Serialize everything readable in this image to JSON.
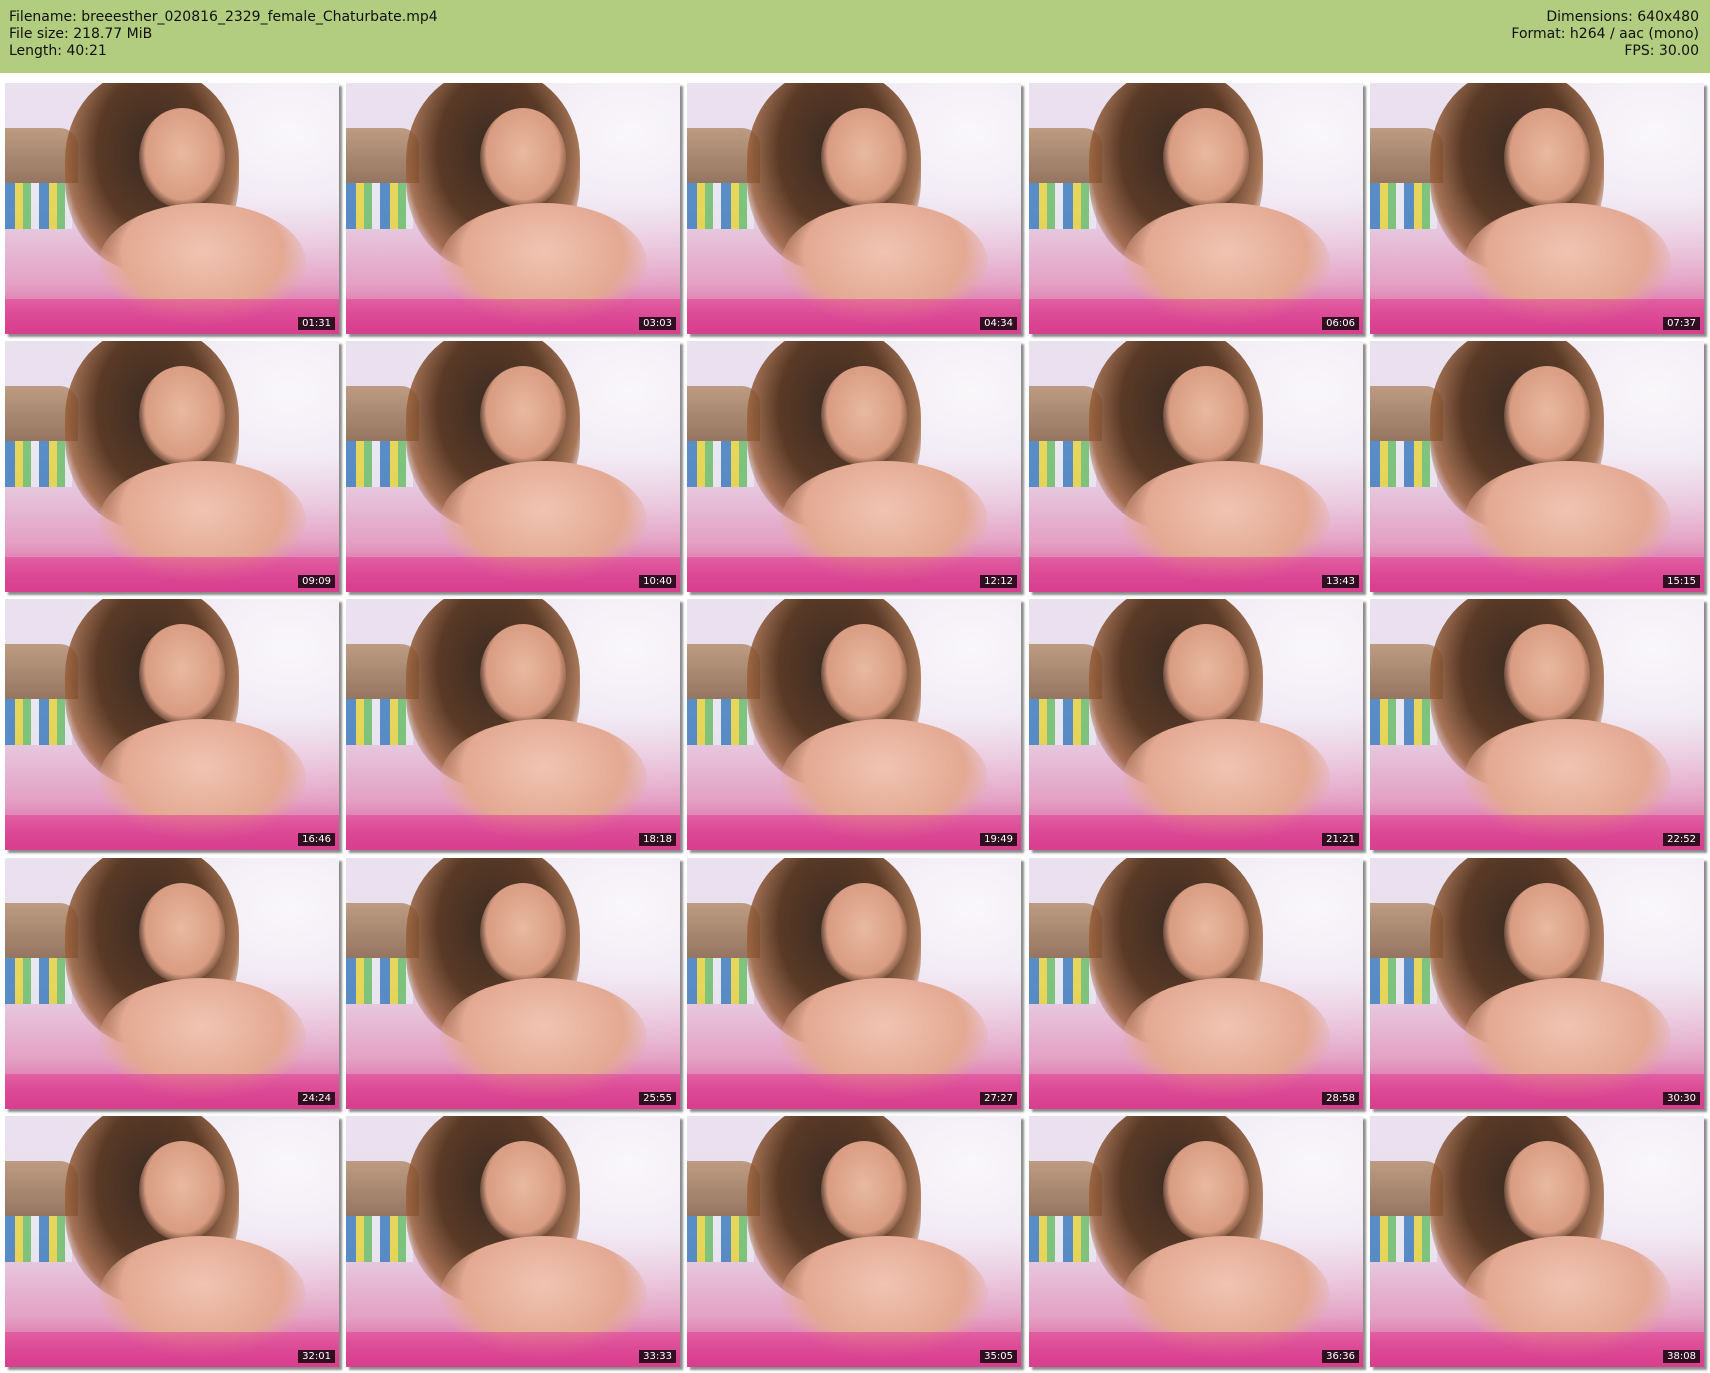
{
  "header": {
    "filename": "Filename: breeesther_020816_2329_female_Chaturbate.mp4",
    "filesize": "File size: 218.77 MiB",
    "length": "Length: 40:21",
    "dimensions": "Dimensions: 640x480",
    "format": "Format: h264 / aac (mono)",
    "fps": "FPS: 30.00"
  },
  "colors": {
    "header_bg": "#b2cd80",
    "page_bg": "#ffffff",
    "timestamp_bg": "#000000",
    "timestamp_text": "#ffffff"
  },
  "thumbnails": [
    {
      "timestamp": "01:31"
    },
    {
      "timestamp": "03:03"
    },
    {
      "timestamp": "04:34"
    },
    {
      "timestamp": "06:06"
    },
    {
      "timestamp": "07:37"
    },
    {
      "timestamp": "09:09"
    },
    {
      "timestamp": "10:40"
    },
    {
      "timestamp": "12:12"
    },
    {
      "timestamp": "13:43"
    },
    {
      "timestamp": "15:15"
    },
    {
      "timestamp": "16:46"
    },
    {
      "timestamp": "18:18"
    },
    {
      "timestamp": "19:49"
    },
    {
      "timestamp": "21:21"
    },
    {
      "timestamp": "22:52"
    },
    {
      "timestamp": "24:24"
    },
    {
      "timestamp": "25:55"
    },
    {
      "timestamp": "27:27"
    },
    {
      "timestamp": "28:58"
    },
    {
      "timestamp": "30:30"
    },
    {
      "timestamp": "32:01"
    },
    {
      "timestamp": "33:33"
    },
    {
      "timestamp": "35:05"
    },
    {
      "timestamp": "36:36"
    },
    {
      "timestamp": "38:08"
    }
  ]
}
